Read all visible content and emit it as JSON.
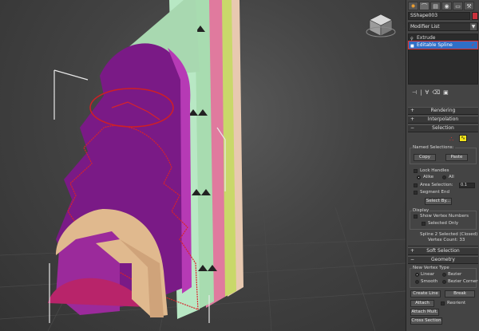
{
  "panel": {
    "tabs": [
      {
        "icon": "sun-icon",
        "glyph": "✹"
      },
      {
        "icon": "modify-icon",
        "glyph": "⌒"
      },
      {
        "icon": "hierarchy-icon",
        "glyph": "▤"
      },
      {
        "icon": "motion-icon",
        "glyph": "◉"
      },
      {
        "icon": "display-icon",
        "glyph": "▭"
      },
      {
        "icon": "utilities-icon",
        "glyph": "⚒"
      }
    ],
    "object_name": "SShape003",
    "object_color": "#c8323c",
    "modifier_list": "Modifier List",
    "stack": [
      {
        "label": "Extrude",
        "selected": false
      },
      {
        "label": "Editable Spline",
        "selected": true
      }
    ],
    "stack_icons": [
      "pin-icon",
      "show-end-result-icon",
      "make-unique-icon",
      "remove-modifier-icon",
      "configure-icon"
    ],
    "rollouts": {
      "rendering": "Rendering",
      "interpolation": "Interpolation",
      "selection": "Selection",
      "soft_selection": "Soft Selection",
      "geometry": "Geometry"
    },
    "selection": {
      "named_selections": "Named Selections:",
      "copy": "Copy",
      "paste": "Paste",
      "lock_handles": "Lock Handles",
      "alike": "Alike",
      "all": "All",
      "area_selection": "Area Selection:",
      "area_value": "0.1",
      "segment_end": "Segment End",
      "select_by": "Select By...",
      "display": "Display",
      "show_vertex_numbers": "Show Vertex Numbers",
      "selected_only": "Selected Only",
      "status_line1": "Spline 2 Selected (Closed)",
      "status_line2": "Vertex Count: 33"
    },
    "geometry": {
      "new_vertex_type": "New Vertex Type",
      "linear": "Linear",
      "bezier": "Bezier",
      "smooth": "Smooth",
      "bezier_corner": "Bezier Corner",
      "create_line": "Create Line",
      "break": "Break",
      "attach": "Attach",
      "reorient": "Reorient",
      "attach_mult": "Attach Mult.",
      "cross_section": "Cross Section"
    }
  }
}
